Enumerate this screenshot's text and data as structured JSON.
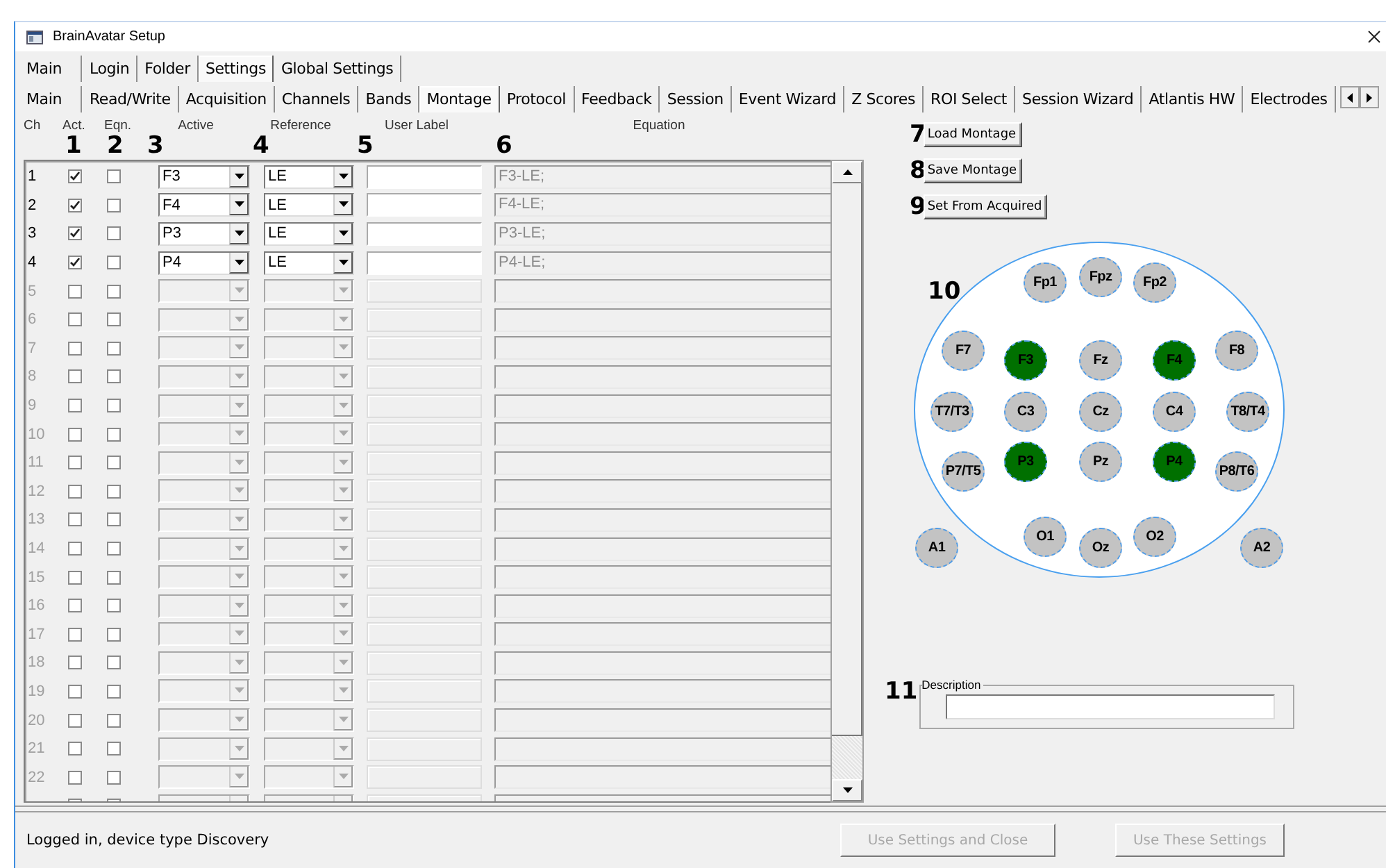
{
  "window": {
    "title": "BrainAvatar Setup"
  },
  "main_tabs": [
    {
      "label": "Main",
      "selected": false
    },
    {
      "label": "Login",
      "selected": false
    },
    {
      "label": "Folder",
      "selected": false
    },
    {
      "label": "Settings",
      "selected": true
    },
    {
      "label": "Global Settings",
      "selected": false
    }
  ],
  "settings_tabs": [
    {
      "label": "Main",
      "selected": false
    },
    {
      "label": "Read/Write",
      "selected": false
    },
    {
      "label": "Acquisition",
      "selected": false
    },
    {
      "label": "Channels",
      "selected": false
    },
    {
      "label": "Bands",
      "selected": false
    },
    {
      "label": "Montage",
      "selected": true
    },
    {
      "label": "Protocol",
      "selected": false
    },
    {
      "label": "Feedback",
      "selected": false
    },
    {
      "label": "Session",
      "selected": false
    },
    {
      "label": "Event Wizard",
      "selected": false
    },
    {
      "label": "Z Scores",
      "selected": false
    },
    {
      "label": "ROI Select",
      "selected": false
    },
    {
      "label": "Session Wizard",
      "selected": false
    },
    {
      "label": "Atlantis HW",
      "selected": false
    },
    {
      "label": "Electrodes",
      "selected": false
    }
  ],
  "montage_table": {
    "columns": [
      {
        "label": "Ch"
      },
      {
        "label": "Act.",
        "callout": "1"
      },
      {
        "label": "Eqn.",
        "callout": "2"
      },
      {
        "label": "Active",
        "callout": "3"
      },
      {
        "label": "Reference",
        "callout": "4"
      },
      {
        "label": "User Label",
        "callout": "5"
      },
      {
        "label": "Equation",
        "callout": "6"
      }
    ],
    "rows": [
      {
        "ch": "1",
        "enabled": true,
        "act": true,
        "eqn": false,
        "active": "F3",
        "reference": "LE",
        "equation": "F3-LE;"
      },
      {
        "ch": "2",
        "enabled": true,
        "act": true,
        "eqn": false,
        "active": "F4",
        "reference": "LE",
        "equation": "F4-LE;"
      },
      {
        "ch": "3",
        "enabled": true,
        "act": true,
        "eqn": false,
        "active": "P3",
        "reference": "LE",
        "equation": "P3-LE;"
      },
      {
        "ch": "4",
        "enabled": true,
        "act": true,
        "eqn": false,
        "active": "P4",
        "reference": "LE",
        "equation": "P4-LE;"
      },
      {
        "ch": "5",
        "enabled": false,
        "act": false,
        "eqn": false
      },
      {
        "ch": "6",
        "enabled": false,
        "act": false,
        "eqn": false
      },
      {
        "ch": "7",
        "enabled": false,
        "act": false,
        "eqn": false
      },
      {
        "ch": "8",
        "enabled": false,
        "act": false,
        "eqn": false
      },
      {
        "ch": "9",
        "enabled": false,
        "act": false,
        "eqn": false
      },
      {
        "ch": "10",
        "enabled": false,
        "act": false,
        "eqn": false
      },
      {
        "ch": "11",
        "enabled": false,
        "act": false,
        "eqn": false
      },
      {
        "ch": "12",
        "enabled": false,
        "act": false,
        "eqn": false
      },
      {
        "ch": "13",
        "enabled": false,
        "act": false,
        "eqn": false
      },
      {
        "ch": "14",
        "enabled": false,
        "act": false,
        "eqn": false
      },
      {
        "ch": "15",
        "enabled": false,
        "act": false,
        "eqn": false
      },
      {
        "ch": "16",
        "enabled": false,
        "act": false,
        "eqn": false
      },
      {
        "ch": "17",
        "enabled": false,
        "act": false,
        "eqn": false
      },
      {
        "ch": "18",
        "enabled": false,
        "act": false,
        "eqn": false
      },
      {
        "ch": "19",
        "enabled": false,
        "act": false,
        "eqn": false
      },
      {
        "ch": "20",
        "enabled": false,
        "act": false,
        "eqn": false
      },
      {
        "ch": "21",
        "enabled": false,
        "act": false,
        "eqn": false
      },
      {
        "ch": "22",
        "enabled": false,
        "act": false,
        "eqn": false
      },
      {
        "enabled": false
      }
    ]
  },
  "montage_buttons": [
    {
      "callout": "7",
      "label": "Load Montage"
    },
    {
      "callout": "8",
      "label": "Save Montage"
    },
    {
      "callout": "9",
      "label": "Set From Acquired"
    }
  ],
  "head_map": {
    "callout": "10",
    "electrodes": [
      {
        "label": "Fp1",
        "active": false
      },
      {
        "label": "Fpz",
        "active": false
      },
      {
        "label": "Fp2",
        "active": false
      },
      {
        "label": "F7",
        "active": false
      },
      {
        "label": "F3",
        "active": true
      },
      {
        "label": "Fz",
        "active": false
      },
      {
        "label": "F4",
        "active": true
      },
      {
        "label": "F8",
        "active": false
      },
      {
        "label": "T7/T3",
        "active": false
      },
      {
        "label": "C3",
        "active": false
      },
      {
        "label": "Cz",
        "active": false
      },
      {
        "label": "C4",
        "active": false
      },
      {
        "label": "T8/T4",
        "active": false
      },
      {
        "label": "P7/T5",
        "active": false
      },
      {
        "label": "P3",
        "active": true
      },
      {
        "label": "Pz",
        "active": false
      },
      {
        "label": "P4",
        "active": true
      },
      {
        "label": "P8/T6",
        "active": false
      },
      {
        "label": "A1",
        "active": false
      },
      {
        "label": "O1",
        "active": false
      },
      {
        "label": "Oz",
        "active": false
      },
      {
        "label": "O2",
        "active": false
      },
      {
        "label": "A2",
        "active": false
      }
    ]
  },
  "description": {
    "callout": "11",
    "label": "Description"
  },
  "status_bar": {
    "message": "Logged in, device type Discovery"
  },
  "footer_buttons": [
    {
      "label": "Use Settings and Close",
      "disabled": true
    },
    {
      "label": "Use These Settings",
      "disabled": true
    }
  ]
}
